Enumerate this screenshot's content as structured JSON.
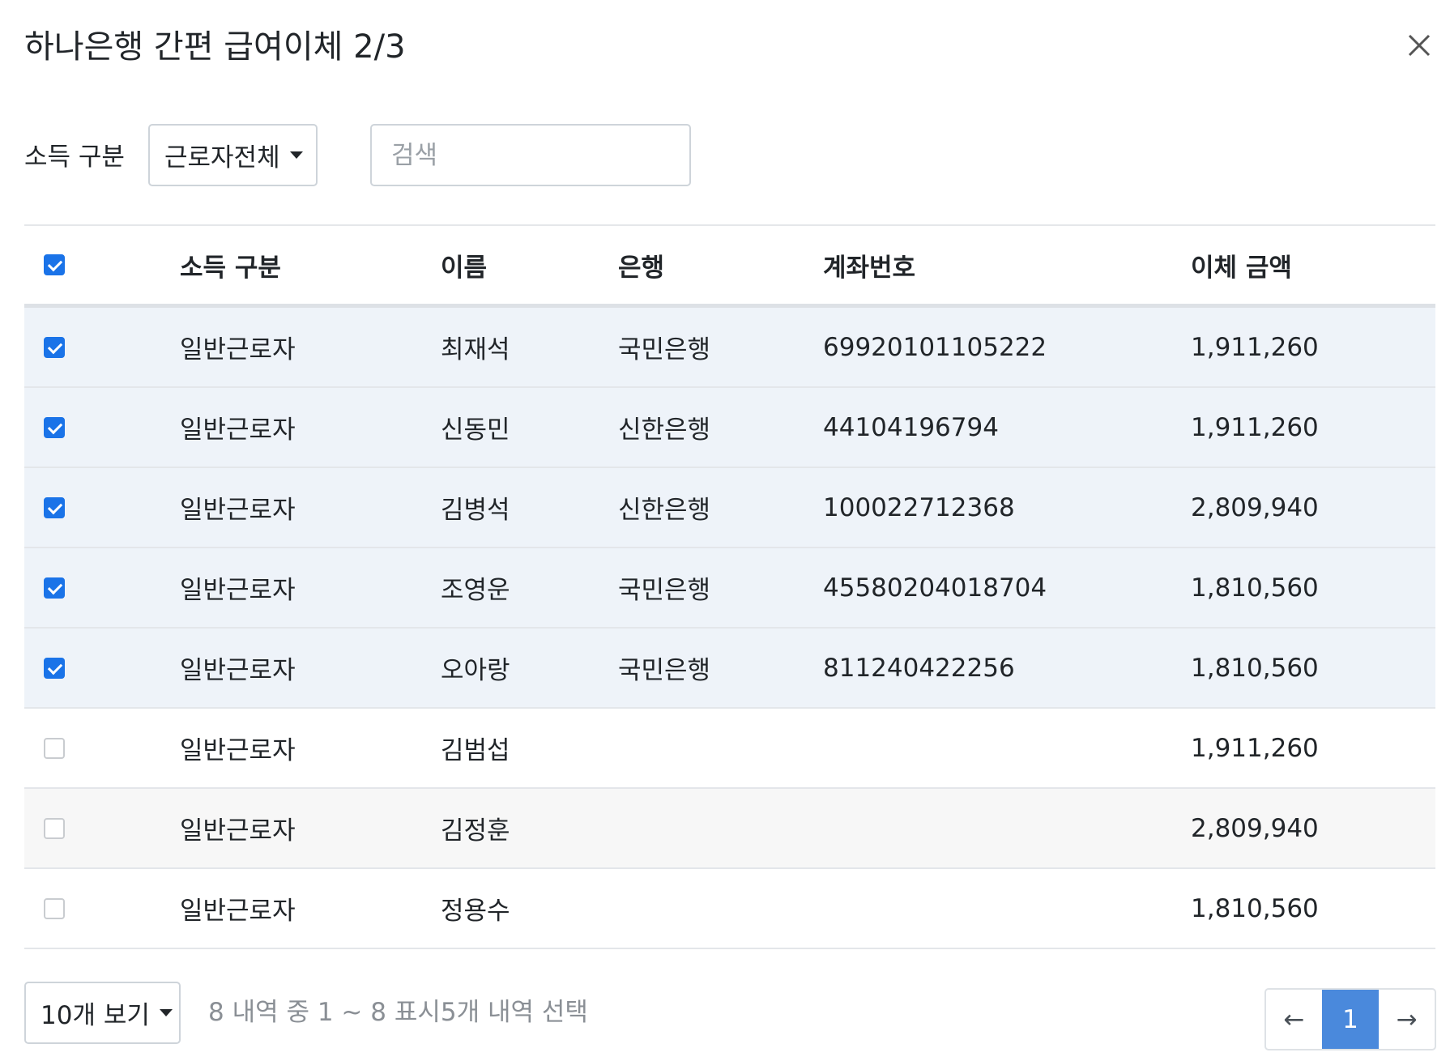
{
  "modal": {
    "title": "하나은행 간편 급여이체 2/3",
    "close_icon": "close-icon"
  },
  "filters": {
    "income_label": "소득 구분",
    "income_selected": "근로자전체",
    "search_placeholder": "검색"
  },
  "table": {
    "columns": [
      "소득 구분",
      "이름",
      "은행",
      "계좌번호",
      "이체 금액"
    ],
    "header_checked": true,
    "rows": [
      {
        "checked": true,
        "type": "일반근로자",
        "name": "최재석",
        "bank": "국민은행",
        "account": "69920101105222",
        "amount": "1,911,260"
      },
      {
        "checked": true,
        "type": "일반근로자",
        "name": "신동민",
        "bank": "신한은행",
        "account": "44104196794",
        "amount": "1,911,260"
      },
      {
        "checked": true,
        "type": "일반근로자",
        "name": "김병석",
        "bank": "신한은행",
        "account": "100022712368",
        "amount": "2,809,940"
      },
      {
        "checked": true,
        "type": "일반근로자",
        "name": "조영운",
        "bank": "국민은행",
        "account": "45580204018704",
        "amount": "1,810,560"
      },
      {
        "checked": true,
        "type": "일반근로자",
        "name": "오아랑",
        "bank": "국민은행",
        "account": "811240422256",
        "amount": "1,810,560"
      },
      {
        "checked": false,
        "type": "일반근로자",
        "name": "김범섭",
        "bank": "",
        "account": "",
        "amount": "1,911,260"
      },
      {
        "checked": false,
        "type": "일반근로자",
        "name": "김정훈",
        "bank": "",
        "account": "",
        "amount": "2,809,940"
      },
      {
        "checked": false,
        "type": "일반근로자",
        "name": "정용수",
        "bank": "",
        "account": "",
        "amount": "1,810,560"
      }
    ]
  },
  "footer": {
    "page_size_label": "10개 보기",
    "summary": "8 내역 중 1 ~ 8 표시5개 내역 선택",
    "prev": "←",
    "current_page": "1",
    "next": "→"
  },
  "colors": {
    "accent": "#1a73e8",
    "active_page": "#4a89dc",
    "selected_row": "#eef3f9"
  }
}
